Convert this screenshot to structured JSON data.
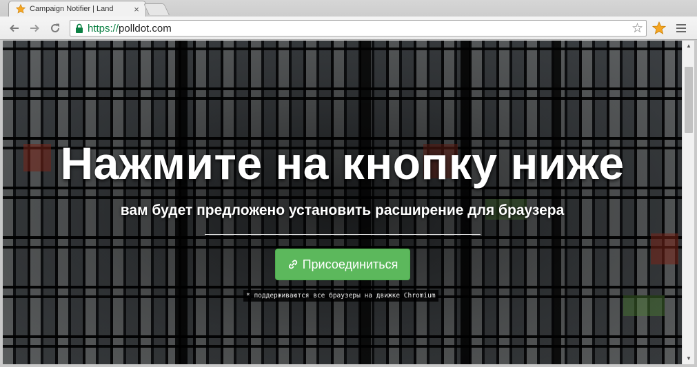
{
  "browser": {
    "tab_title": "Campaign Notifier | Land",
    "tab_close": "×",
    "url_scheme": "https://",
    "url_host": "polldot.com",
    "icons": {
      "back": "arrow-left-icon",
      "forward": "arrow-right-icon",
      "reload": "reload-icon",
      "lock": "lock-icon",
      "bookmark": "star-icon",
      "extension": "campaign-notifier-extension-icon",
      "menu": "hamburger-menu-icon"
    },
    "colors": {
      "secure": "#0b8043",
      "extension": "#f5a623"
    }
  },
  "page": {
    "headline": "Нажмите на кнопку ниже",
    "subline": "вам будет предложено установить расширение для браузера",
    "button_label": "Присоединиться",
    "note": "* поддерживаются все браузеры на движке Chromium",
    "colors": {
      "button": "#5cb85c",
      "text": "#ffffff"
    }
  }
}
